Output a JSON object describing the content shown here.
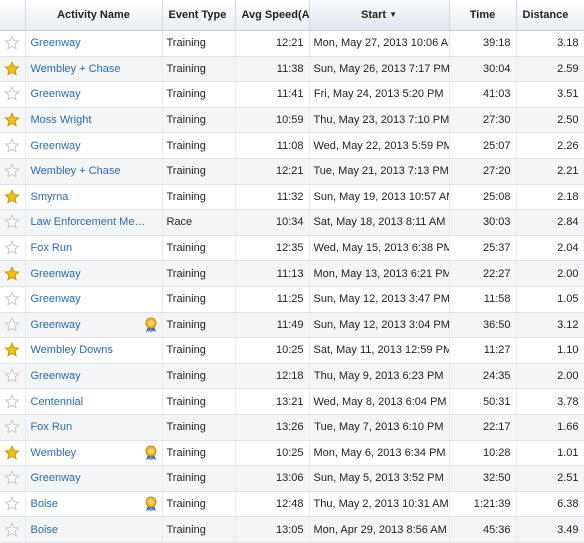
{
  "columns": {
    "activity_name": "Activity Name",
    "event_type": "Event Type",
    "avg_speed": "Avg Speed(Av",
    "start": "Start",
    "time": "Time",
    "distance": "Distance"
  },
  "sort": {
    "column": "start",
    "direction": "descending",
    "icon": "sort-down-arrow-icon"
  },
  "colors": {
    "link": "#2a6bb8",
    "star_active": "#f4c20d",
    "star_inactive": "#c8c8c8",
    "badge": "#e8a317"
  },
  "rows": [
    {
      "favorite": false,
      "name": "Greenway",
      "badge": false,
      "type": "Training",
      "speed": "12:21",
      "start": "Mon, May 27, 2013 10:06 AM",
      "time": "39:18",
      "distance": "3.18"
    },
    {
      "favorite": true,
      "name": "Wembley + Chase",
      "badge": false,
      "type": "Training",
      "speed": "11:38",
      "start": "Sun, May 26, 2013 7:17 PM",
      "time": "30:04",
      "distance": "2.59"
    },
    {
      "favorite": false,
      "name": "Greenway",
      "badge": false,
      "type": "Training",
      "speed": "11:41",
      "start": "Fri, May 24, 2013 5:20 PM",
      "time": "41:03",
      "distance": "3.51"
    },
    {
      "favorite": true,
      "name": "Moss Wright",
      "badge": false,
      "type": "Training",
      "speed": "10:59",
      "start": "Thu, May 23, 2013 7:10 PM",
      "time": "27:30",
      "distance": "2.50"
    },
    {
      "favorite": false,
      "name": "Greenway",
      "badge": false,
      "type": "Training",
      "speed": "11:08",
      "start": "Wed, May 22, 2013 5:59 PM",
      "time": "25:07",
      "distance": "2.26"
    },
    {
      "favorite": false,
      "name": "Wembley + Chase",
      "badge": false,
      "type": "Training",
      "speed": "12:21",
      "start": "Tue, May 21, 2013 7:13 PM",
      "time": "27:20",
      "distance": "2.21"
    },
    {
      "favorite": true,
      "name": "Smyrna",
      "badge": false,
      "type": "Training",
      "speed": "11:32",
      "start": "Sun, May 19, 2013 10:57 AM",
      "time": "25:08",
      "distance": "2.18"
    },
    {
      "favorite": false,
      "name": "Law Enforcement Me…",
      "badge": false,
      "type": "Race",
      "speed": "10:34",
      "start": "Sat, May 18, 2013 8:11 AM",
      "time": "30:03",
      "distance": "2.84"
    },
    {
      "favorite": false,
      "name": "Fox Run",
      "badge": false,
      "type": "Training",
      "speed": "12:35",
      "start": "Wed, May 15, 2013 6:38 PM",
      "time": "25:37",
      "distance": "2.04"
    },
    {
      "favorite": true,
      "name": "Greenway",
      "badge": false,
      "type": "Training",
      "speed": "11:13",
      "start": "Mon, May 13, 2013 6:21 PM",
      "time": "22:27",
      "distance": "2.00"
    },
    {
      "favorite": false,
      "name": "Greenway",
      "badge": false,
      "type": "Training",
      "speed": "11:25",
      "start": "Sun, May 12, 2013 3:47 PM",
      "time": "11:58",
      "distance": "1.05"
    },
    {
      "favorite": false,
      "name": "Greenway",
      "badge": true,
      "type": "Training",
      "speed": "11:49",
      "start": "Sun, May 12, 2013 3:04 PM",
      "time": "36:50",
      "distance": "3.12"
    },
    {
      "favorite": true,
      "name": "Wembley Downs",
      "badge": false,
      "type": "Training",
      "speed": "10:25",
      "start": "Sat, May 11, 2013 12:59 PM",
      "time": "11:27",
      "distance": "1.10"
    },
    {
      "favorite": false,
      "name": "Greenway",
      "badge": false,
      "type": "Training",
      "speed": "12:18",
      "start": "Thu, May 9, 2013 6:23 PM",
      "time": "24:35",
      "distance": "2.00"
    },
    {
      "favorite": false,
      "name": "Centennial",
      "badge": false,
      "type": "Training",
      "speed": "13:21",
      "start": "Wed, May 8, 2013 6:04 PM",
      "time": "50:31",
      "distance": "3.78"
    },
    {
      "favorite": false,
      "name": "Fox Run",
      "badge": false,
      "type": "Training",
      "speed": "13:26",
      "start": "Tue, May 7, 2013 6:10 PM",
      "time": "22:17",
      "distance": "1.66"
    },
    {
      "favorite": true,
      "name": "Wembley",
      "badge": true,
      "type": "Training",
      "speed": "10:25",
      "start": "Mon, May 6, 2013 6:34 PM",
      "time": "10:28",
      "distance": "1.01"
    },
    {
      "favorite": false,
      "name": "Greenway",
      "badge": false,
      "type": "Training",
      "speed": "13:06",
      "start": "Sun, May 5, 2013 3:52 PM",
      "time": "32:50",
      "distance": "2.51"
    },
    {
      "favorite": false,
      "name": "Boise",
      "badge": true,
      "type": "Training",
      "speed": "12:48",
      "start": "Thu, May 2, 2013 10:31 AM",
      "time": "1:21:39",
      "distance": "6.38"
    },
    {
      "favorite": false,
      "name": "Boise",
      "badge": false,
      "type": "Training",
      "speed": "13:05",
      "start": "Mon, Apr 29, 2013 8:56 AM",
      "time": "45:36",
      "distance": "3.49"
    }
  ]
}
